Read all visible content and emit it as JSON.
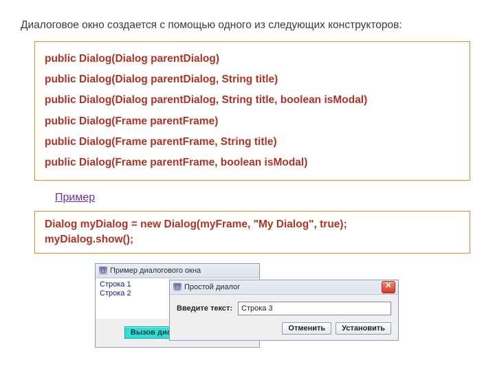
{
  "intro": "Диалоговое окно создается с помощью одного из следующих конструкторов:",
  "constructors": [
    "public Dialog(Dialog parentDialog)",
    "public Dialog(Dialog parentDialog, String title)",
    "public Dialog(Dialog parentDialog, String title, boolean isModal)",
    "public Dialog(Frame parentFrame)",
    "public Dialog(Frame parentFrame, String title)",
    "public Dialog(Frame parentFrame, boolean isModal)"
  ],
  "example_label": "Пример",
  "example_code": [
    "Dialog myDialog = new Dialog(myFrame, \"My Dialog\", true);",
    "myDialog.show();"
  ],
  "back_window": {
    "title": "Пример диалогового окна",
    "line1": "Строка 1",
    "line2": "Строка 2",
    "button": "Вызов диалогового окна"
  },
  "front_window": {
    "title": "Простой диалог",
    "label": "Введите текст:",
    "input_value": "Строка 3",
    "cancel": "Отменить",
    "set": "Установить",
    "close": "✕"
  }
}
